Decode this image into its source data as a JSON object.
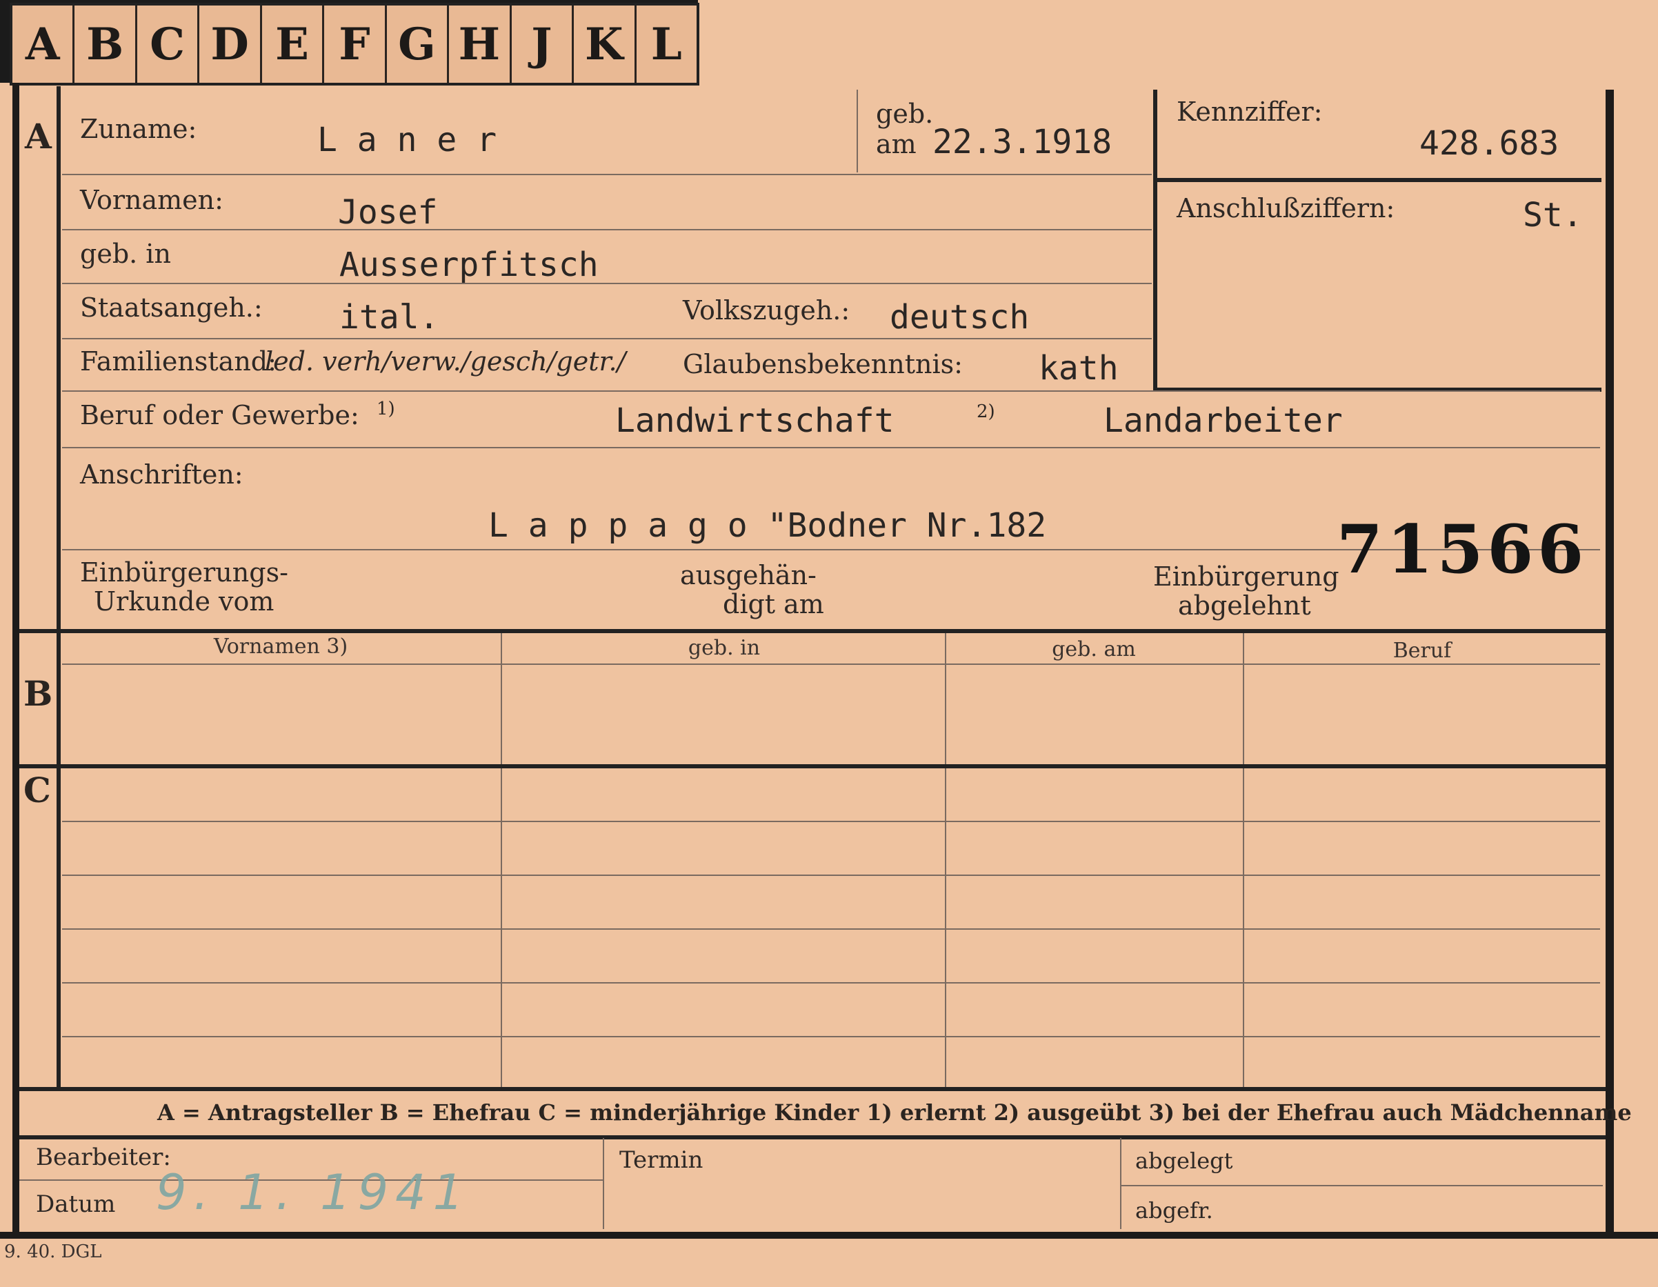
{
  "tabs": [
    "A",
    "B",
    "C",
    "D",
    "E",
    "F",
    "G",
    "H",
    "J",
    "K",
    "L"
  ],
  "sections": {
    "a": "A",
    "b": "B",
    "c": "C"
  },
  "zuname": {
    "label": "Zuname:",
    "value": "L a n e r"
  },
  "geb_am": {
    "label_top": "geb.",
    "label_bottom": "am",
    "value": "22.3.1918"
  },
  "kennziffer": {
    "label": "Kennziffer:",
    "value": "428.683"
  },
  "vornamen": {
    "label": "Vornamen:",
    "value": "Josef"
  },
  "anschlussziffern": {
    "label": "Anschlußziffern:",
    "value": "St."
  },
  "geb_in": {
    "label": "geb. in",
    "value": "Ausserpfitsch"
  },
  "staatsangeh": {
    "label": "Staatsangeh.:",
    "value": "ital."
  },
  "volkszugeh": {
    "label": "Volkszugeh.:",
    "value": "deutsch"
  },
  "familienstand": {
    "label": "Familienstand:",
    "value": "led. verh/verw./gesch/getr./"
  },
  "glaubensbekenntnis": {
    "label": "Glaubensbekenntnis:",
    "value": "kath"
  },
  "beruf": {
    "label": "Beruf oder Gewerbe:",
    "marker1": "1)",
    "value1": "Landwirtschaft",
    "marker2": "2)",
    "value2": "Landarbeiter"
  },
  "anschriften": {
    "label": "Anschriften:",
    "value": "L a p p a g o \"Bodner Nr.182"
  },
  "stamp_number": "71566",
  "einbuergerung": {
    "urkunde_line1": "Einbürgerungs-",
    "urkunde_line2": "Urkunde vom",
    "ausgehaendigt_line1": "ausgehän-",
    "ausgehaendigt_line2": "digt am",
    "abgelehnt_line1": "Einbürgerung",
    "abgelehnt_line2": "abgelehnt"
  },
  "columns": [
    "Vornamen 3)",
    "geb. in",
    "geb. am",
    "Beruf"
  ],
  "legend": "A = Antragsteller   B = Ehefrau   C = minderjährige Kinder   1) erlernt   2) ausgeübt   3) bei der Ehefrau auch Mädchenname",
  "footer": {
    "bearbeiter": "Bearbeiter:",
    "datum": "Datum",
    "datum_value": "9. 1. 1941",
    "termin": "Termin",
    "abgelegt": "abgelegt",
    "abgefr": "abgefr."
  },
  "print_code": "9. 40. DGL",
  "colors": {
    "card": "#efc3a0",
    "ink": "#222222",
    "handwriting": "#7fa6a3"
  }
}
